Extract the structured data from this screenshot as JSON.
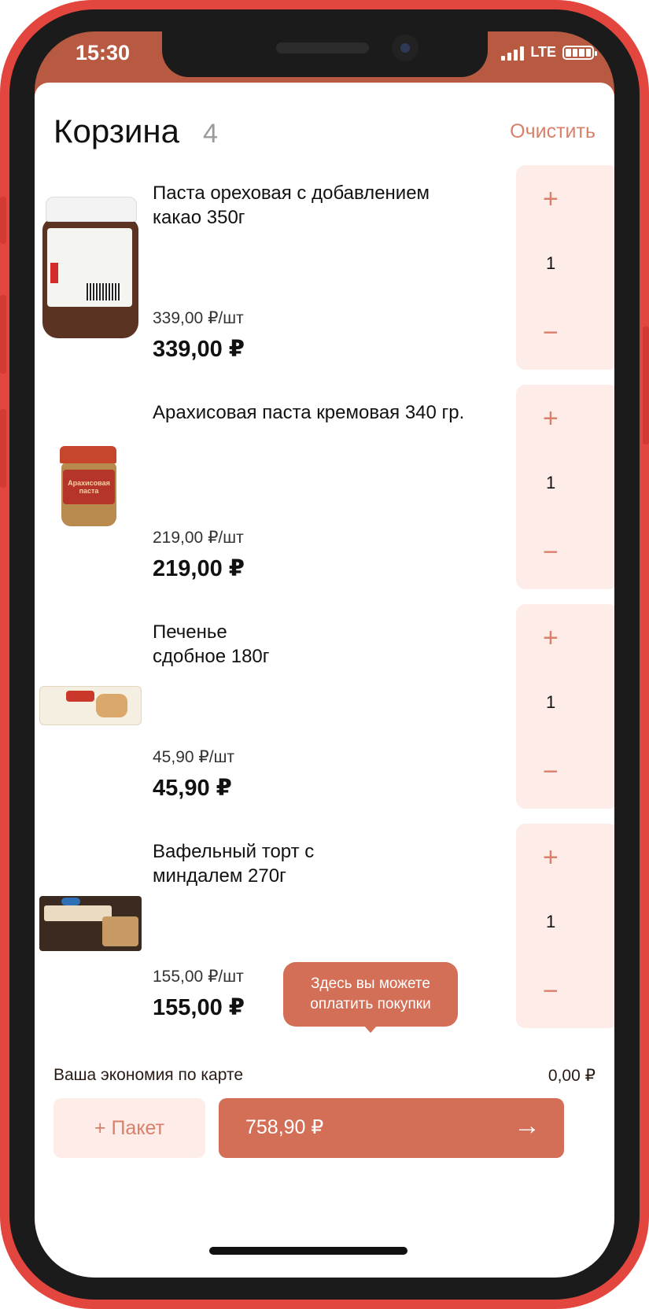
{
  "status": {
    "time": "15:30",
    "network": "LTE"
  },
  "header": {
    "title": "Корзина",
    "count": "4",
    "clear_label": "Очистить"
  },
  "items": [
    {
      "name": "Паста ореховая с добавлением какао 350г",
      "unit_price": "339,00 ₽/шт",
      "total": "339,00 ₽",
      "qty": "1",
      "image": "chocolate-nut-paste-jar"
    },
    {
      "name": "Арахисовая паста кремовая 340 гр.",
      "unit_price": "219,00 ₽/шт",
      "total": "219,00 ₽",
      "qty": "1",
      "image": "peanut-butter-jar"
    },
    {
      "name": "Печенье сдобное 180г",
      "unit_price": "45,90 ₽/шт",
      "total": "45,90 ₽",
      "qty": "1",
      "image": "cookie-pack"
    },
    {
      "name": "Вафельный торт с миндалем 270г",
      "unit_price": "155,00 ₽/шт",
      "total": "155,00 ₽",
      "qty": "1",
      "image": "wafer-cake-box"
    }
  ],
  "stepper": {
    "plus": "+",
    "minus": "−"
  },
  "jar2_label": "Арахисовая паста",
  "tooltip": {
    "line1": "Здесь вы можете",
    "line2": "оплатить покупки"
  },
  "savings": {
    "label": "Ваша экономия по карте",
    "value": "0,00 ₽"
  },
  "footer": {
    "bag_label": "+ Пакет",
    "pay_amount": "758,90 ₽",
    "pay_arrow": "→"
  },
  "colors": {
    "accent": "#d46f57",
    "accent_light": "#fdece7",
    "header_bar": "#b85a42",
    "frame": "#e2463f"
  }
}
